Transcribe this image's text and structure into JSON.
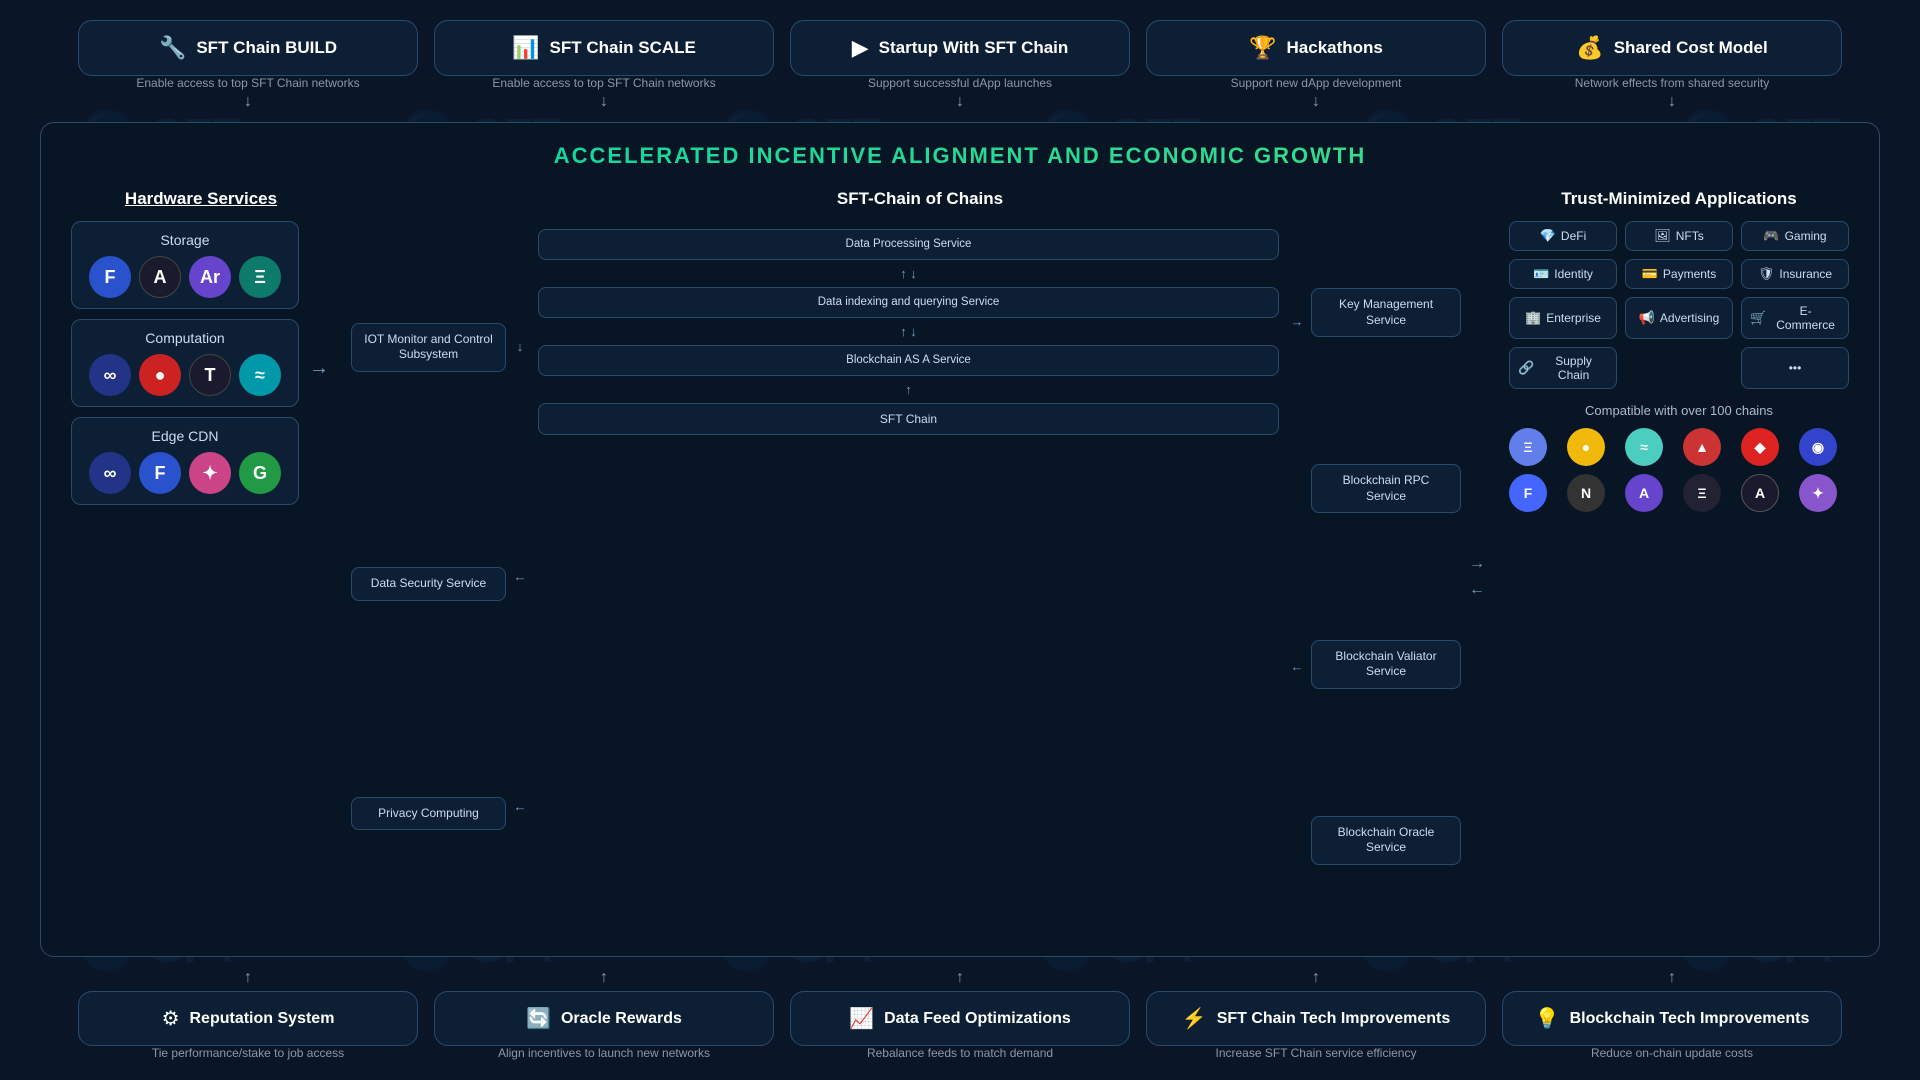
{
  "watermark": {
    "text": "🔵 SFT"
  },
  "top_cards": [
    {
      "id": "sft-build",
      "icon": "🔧",
      "title": "SFT Chain BUILD",
      "desc": "Enable access to top SFT Chain networks"
    },
    {
      "id": "sft-scale",
      "icon": "📊",
      "title": "SFT Chain SCALE",
      "desc": "Enable access to top SFT Chain networks"
    },
    {
      "id": "startup",
      "icon": "▶",
      "title": "Startup With SFT Chain",
      "desc": "Support successful dApp launches"
    },
    {
      "id": "hackathons",
      "icon": "🏆",
      "title": "Hackathons",
      "desc": "Support new dApp development"
    },
    {
      "id": "shared-cost",
      "icon": "💰",
      "title": "Shared Cost Model",
      "desc": "Network effects from shared security"
    }
  ],
  "middle": {
    "headline": "ACCELERATED INCENTIVE ALIGNMENT AND ECONOMIC GROWTH",
    "hardware": {
      "title": "Hardware Services",
      "storage": {
        "label": "Storage",
        "icons": [
          "F",
          "A",
          "Ar",
          "Ξ"
        ]
      },
      "computation": {
        "label": "Computation",
        "icons": [
          "∞",
          "●",
          "T",
          "≈"
        ]
      },
      "edge_cdn": {
        "label": "Edge CDN",
        "icons": [
          "∞",
          "F",
          "✦",
          "G"
        ]
      }
    },
    "chain_of_chains": {
      "title": "SFT-Chain of Chains",
      "left_services": [
        "IOT Monitor and Control Subsystem",
        "Data Security Service",
        "Privacy Computing"
      ],
      "center_services": [
        "Data Processing Service",
        "Data indexing and querying Service",
        "Blockchain AS A Service",
        "SFT Chain"
      ],
      "right_services": [
        "Key Management Service",
        "Blockchain RPC Service",
        "Blockchain Valiator Service",
        "Blockchain Oracle Service"
      ]
    },
    "trust": {
      "title": "Trust-Minimized Applications",
      "items": [
        {
          "icon": "💎",
          "label": "DeFi"
        },
        {
          "icon": "🖼",
          "label": "NFTs"
        },
        {
          "icon": "🎮",
          "label": "Gaming"
        },
        {
          "icon": "🪪",
          "label": "Identity"
        },
        {
          "icon": "💳",
          "label": "Payments"
        },
        {
          "icon": "🛡",
          "label": "Insurance"
        },
        {
          "icon": "🏢",
          "label": "Enterprise"
        },
        {
          "icon": "📢",
          "label": "Advertising"
        },
        {
          "icon": "🛒",
          "label": "E-Commerce"
        },
        {
          "icon": "🔗",
          "label": "Supply Chain"
        },
        {
          "icon": "•••",
          "label": "More"
        }
      ],
      "compat_title": "Compatible with over 100 chains",
      "chain_icons_row1": [
        {
          "bg": "#627eea",
          "label": "Ξ"
        },
        {
          "bg": "#f0b90b",
          "label": "●"
        },
        {
          "bg": "#4bcdc0",
          "label": "≈"
        },
        {
          "bg": "#cc3333",
          "label": "▲"
        },
        {
          "bg": "#dd2222",
          "label": "◆"
        },
        {
          "bg": "#3344cc",
          "label": "◉"
        }
      ],
      "chain_icons_row2": [
        {
          "bg": "#4466ff",
          "label": "F"
        },
        {
          "bg": "#333333",
          "label": "N"
        },
        {
          "bg": "#6644cc",
          "label": "A"
        },
        {
          "bg": "#222233",
          "label": "Ξ"
        },
        {
          "bg": "#1a1a2e",
          "label": "A"
        },
        {
          "bg": "#8855cc",
          "label": "✦"
        }
      ]
    }
  },
  "bottom_cards": [
    {
      "id": "reputation",
      "icon": "⚙",
      "title": "Reputation System",
      "desc": "Tie performance/stake to job access"
    },
    {
      "id": "oracle-rewards",
      "icon": "🔄",
      "title": "Oracle Rewards",
      "desc": "Align incentives to launch new networks"
    },
    {
      "id": "data-feed",
      "icon": "📈",
      "title": "Data Feed Optimizations",
      "desc": "Rebalance feeds to match demand"
    },
    {
      "id": "sft-tech",
      "icon": "⚡",
      "title": "SFT Chain Tech Improvements",
      "desc": "Increase SFT Chain service efficiency"
    },
    {
      "id": "blockchain-tech",
      "icon": "💡",
      "title": "Blockchain Tech Improvements",
      "desc": "Reduce on-chain update costs"
    }
  ]
}
